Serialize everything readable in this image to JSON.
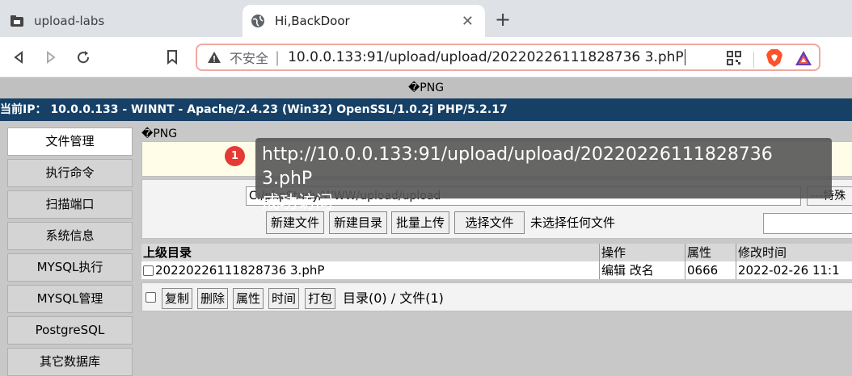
{
  "browser": {
    "tabs": [
      {
        "title": "upload-labs",
        "icon": "folder-icon"
      },
      {
        "title": "Hi,BackDoor",
        "icon": "globe-icon"
      }
    ],
    "new_tab": "+",
    "address": {
      "security_label": "不安全",
      "separator": "|",
      "url": "10.0.0.133:91/upload/upload/20220226111828736 3.phP"
    }
  },
  "page": {
    "png_header": "�PNG",
    "server_info": "当前IP： 10.0.0.133 - WINNT - Apache/2.4.23 (Win32) OpenSSL/1.0.2j PHP/5.2.17",
    "sidebar": [
      {
        "label": "文件管理"
      },
      {
        "label": "执行命令"
      },
      {
        "label": "扫描端口"
      },
      {
        "label": "系统信息"
      },
      {
        "label": "MYSQL执行"
      },
      {
        "label": "MYSQL管理"
      },
      {
        "label": "PostgreSQL"
      },
      {
        "label": "其它数据库"
      }
    ],
    "png_inline": "�PNG",
    "path_value": "C:/phpStudy/WWW/upload/upload",
    "special_select": "---特殊",
    "buttons": {
      "new_file": "新建文件",
      "new_dir": "新建目录",
      "batch_upload": "批量上传",
      "choose_file": "选择文件",
      "no_file": "未选择任何文件"
    },
    "table": {
      "headers": [
        "上级目录",
        "操作",
        "属性",
        "修改时间"
      ],
      "rows": [
        {
          "name": "20220226111828736 3.phP",
          "actions": "编辑 改名",
          "attr": "0666",
          "mtime": "2022-02-26 11:1"
        }
      ]
    },
    "bottom": {
      "copy": "复制",
      "delete": "删除",
      "attr": "属性",
      "time": "时间",
      "pack": "打包",
      "summary": "目录(0) / 文件(1)"
    }
  },
  "annotation": {
    "badge": "1",
    "line1": "http://10.0.0.133:91/upload/upload/20220226111828736 3.phP",
    "line2": "成功访问"
  }
}
